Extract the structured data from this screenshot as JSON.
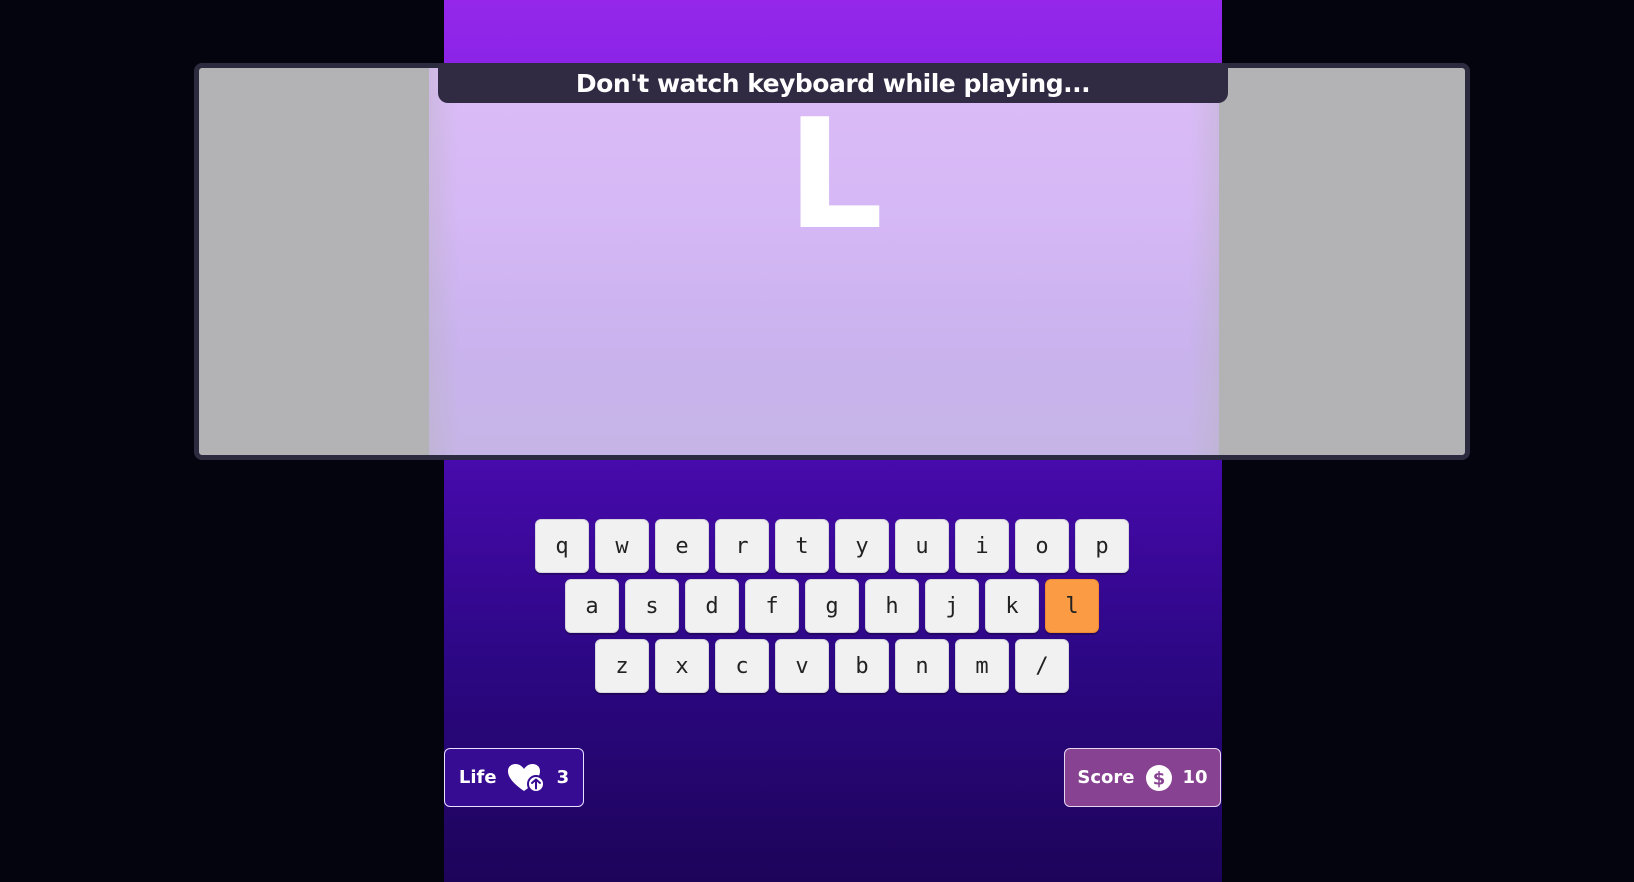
{
  "banner": {
    "text": "Don't watch keyboard while playing..."
  },
  "target": {
    "letter": "L"
  },
  "keyboard": {
    "rows": [
      [
        "q",
        "w",
        "e",
        "r",
        "t",
        "y",
        "u",
        "i",
        "o",
        "p"
      ],
      [
        "a",
        "s",
        "d",
        "f",
        "g",
        "h",
        "j",
        "k",
        "l"
      ],
      [
        "z",
        "x",
        "c",
        "v",
        "b",
        "n",
        "m",
        "/"
      ]
    ],
    "active_key": "l"
  },
  "life": {
    "label": "Life",
    "value": "3",
    "icon": "heart-plus-icon"
  },
  "score": {
    "label": "Score",
    "value": "10",
    "icon": "dollar-coin-icon"
  },
  "colors": {
    "active_key": "#fb9b44",
    "life_bg": "#350c92",
    "score_bg": "#874292"
  }
}
